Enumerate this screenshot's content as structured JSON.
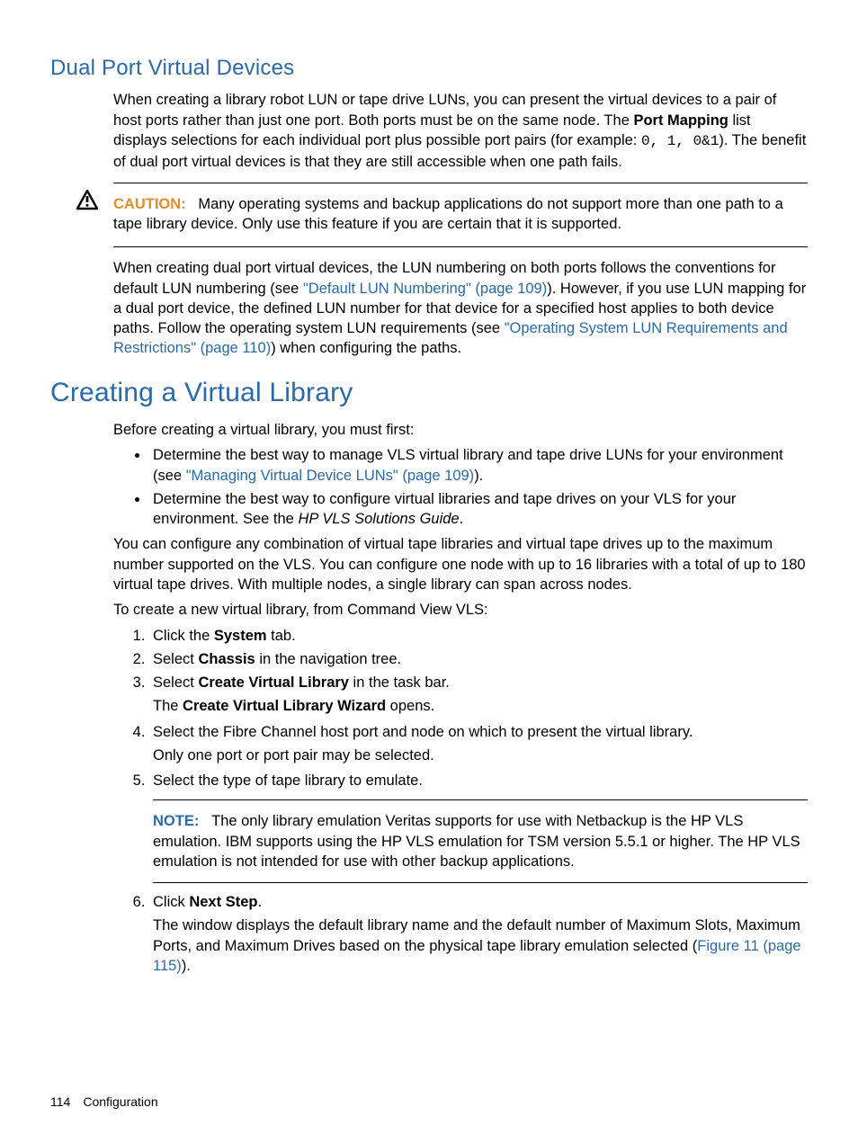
{
  "section1": {
    "title": "Dual Port Virtual Devices",
    "para1_a": "When creating a library robot LUN or tape drive LUNs, you can present the virtual devices to a pair of host ports rather than just one port. Both ports must be on the same node. The ",
    "para1_bold": "Port Mapping",
    "para1_b": " list displays selections for each individual port plus possible port pairs (for example: ",
    "para1_mono": "0, 1, 0&1",
    "para1_c": "). The benefit of dual port virtual devices is that they are still accessible when one path fails.",
    "caution_label": "CAUTION:",
    "caution_text": "Many operating systems and backup applications do not support more than one path to a tape library device. Only use this feature if you are certain that it is supported.",
    "para2_a": "When creating dual port virtual devices, the LUN numbering on both ports follows the conventions for default LUN numbering (see ",
    "para2_link1": "\"Default LUN Numbering\" (page 109)",
    "para2_b": "). However, if you use LUN mapping for a dual port device, the defined LUN number for that device for a specified host applies to both device paths. Follow the operating system LUN requirements (see ",
    "para2_link2": "\"Operating System LUN Requirements and Restrictions\" (page 110)",
    "para2_c": ") when configuring the paths."
  },
  "section2": {
    "title": "Creating a Virtual Library",
    "intro": "Before creating a virtual library, you must first:",
    "bullets": {
      "0": {
        "a": "Determine the best way to manage VLS virtual library and tape drive LUNs for your environment (see ",
        "link": "\"Managing Virtual Device LUNs\" (page 109)",
        "b": ")."
      },
      "1": {
        "a": "Determine the best way to configure virtual libraries and tape drives on your VLS for your environment. See the ",
        "i": "HP VLS Solutions Guide",
        "b": "."
      }
    },
    "para_after_bullets": "You can configure any combination of virtual tape libraries and virtual tape drives up to the maximum number supported on the VLS. You can configure one node with up to 16 libraries with a total of up to 180 virtual tape drives. With multiple nodes, a single library can span across nodes.",
    "para_to_create": "To create a new virtual library, from Command View VLS:",
    "steps": {
      "0": {
        "a": "Click the ",
        "b": "System",
        "c": " tab."
      },
      "1": {
        "a": "Select ",
        "b": "Chassis",
        "c": " in the navigation tree."
      },
      "2": {
        "a": "Select ",
        "b": "Create Virtual Library",
        "c": " in the task bar.",
        "sub_a": "The ",
        "sub_b": "Create Virtual Library Wizard",
        "sub_c": " opens."
      },
      "3": {
        "a": "Select the Fibre Channel host port and node on which to present the virtual library.",
        "sub": "Only one port or port pair may be selected."
      },
      "4": {
        "a": "Select the type of tape library to emulate.",
        "note_label": "NOTE:",
        "note": "The only library emulation Veritas supports for use with Netbackup is the HP VLS emulation. IBM supports using the HP VLS emulation for TSM version 5.5.1 or higher. The HP VLS emulation is not intended for use with other backup applications."
      },
      "5": {
        "a": "Click ",
        "b": "Next Step",
        "c": ".",
        "sub_a": "The window displays the default library name and the default number of Maximum Slots, Maximum Ports, and Maximum Drives based on the physical tape library emulation selected (",
        "sub_link": "Figure 11 (page 115)",
        "sub_b": ")."
      }
    }
  },
  "footer": {
    "page": "114",
    "label": "Configuration"
  }
}
